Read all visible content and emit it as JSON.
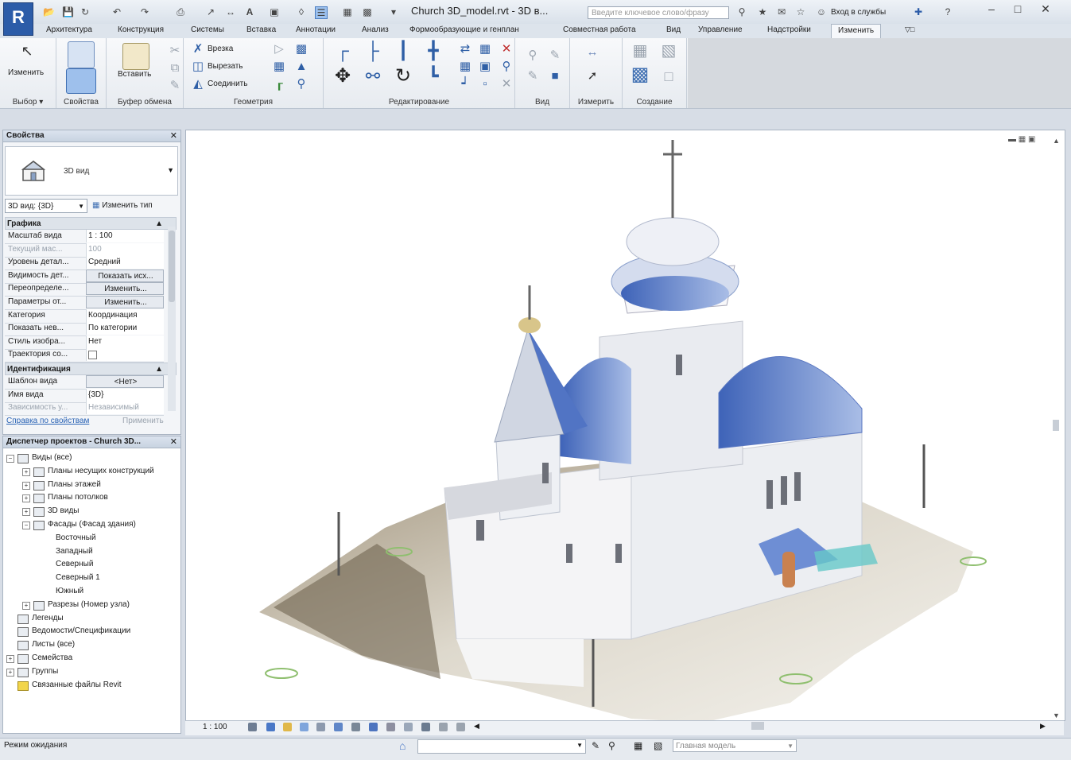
{
  "app": {
    "logo": "R",
    "window_title": "Church 3D_model.rvt - 3D в...",
    "search_placeholder": "Введите ключевое слово/фразу",
    "signin": "Вход в службы",
    "win_buttons": [
      "–",
      "□",
      "✕"
    ]
  },
  "ribbon_tabs": [
    "Архитектура",
    "Конструкция",
    "Системы",
    "Вставка",
    "Аннотации",
    "Анализ",
    "Формообразующие и генплан",
    "Совместная работа",
    "Вид",
    "Управление",
    "Надстройки",
    "Изменить"
  ],
  "ribbon_panels": {
    "select": "Выбор",
    "properties": "Свойства",
    "clipboard": "Буфер обмена",
    "geometry": "Геометрия",
    "modify": "Редактирование",
    "view": "Вид",
    "measure": "Измерить",
    "create": "Создание"
  },
  "ribbon_labels": {
    "modify_btn": "Изменить",
    "paste_btn": "Вставить",
    "cope": "Врезка",
    "cut": "Вырезать",
    "join": "Соединить"
  },
  "properties_pane": {
    "title": "Свойства",
    "type_name": "3D вид",
    "view_selector": "3D вид: {3D}",
    "edit_type": "Изменить тип",
    "groups": {
      "graphics": "Графика",
      "identity": "Идентификация"
    },
    "rows_graphics": [
      {
        "name": "Масштаб вида",
        "value": "1 : 100"
      },
      {
        "name": "Текущий мас...",
        "value": "100"
      },
      {
        "name": "Уровень детал...",
        "value": "Средний"
      },
      {
        "name": "Видимость дет...",
        "value": "Показать исх..."
      },
      {
        "name": "Переопределе...",
        "value": "Изменить..."
      },
      {
        "name": "Параметры от...",
        "value": "Изменить..."
      },
      {
        "name": "Категория",
        "value": "Координация"
      },
      {
        "name": "Показать нев...",
        "value": "По категории"
      },
      {
        "name": "Стиль изобра...",
        "value": "Нет"
      },
      {
        "name": "Траектория со...",
        "value": ""
      }
    ],
    "rows_identity": [
      {
        "name": "Шаблон вида",
        "value": "<Нет>"
      },
      {
        "name": "Имя вида",
        "value": "{3D}"
      },
      {
        "name": "Зависимость у...",
        "value": "Независимый"
      }
    ],
    "help_link": "Справка по свойствам",
    "apply": "Применить"
  },
  "browser_pane": {
    "title": "Диспетчер проектов - Church 3D...",
    "tree": [
      {
        "label": "Виды (все)",
        "level": 0,
        "toggle": "−"
      },
      {
        "label": "Планы несущих конструкций",
        "level": 1,
        "toggle": "+"
      },
      {
        "label": "Планы этажей",
        "level": 1,
        "toggle": "+"
      },
      {
        "label": "Планы потолков",
        "level": 1,
        "toggle": "+"
      },
      {
        "label": "3D виды",
        "level": 1,
        "toggle": "+"
      },
      {
        "label": "Фасады (Фасад здания)",
        "level": 1,
        "toggle": "−"
      },
      {
        "label": "Восточный",
        "level": 2,
        "toggle": ""
      },
      {
        "label": "Западный",
        "level": 2,
        "toggle": ""
      },
      {
        "label": "Северный",
        "level": 2,
        "toggle": ""
      },
      {
        "label": "Северный 1",
        "level": 2,
        "toggle": ""
      },
      {
        "label": "Южный",
        "level": 2,
        "toggle": ""
      },
      {
        "label": "Разрезы (Номер узла)",
        "level": 1,
        "toggle": "+"
      },
      {
        "label": "Легенды",
        "level": 0,
        "toggle": ""
      },
      {
        "label": "Ведомости/Спецификации",
        "level": 0,
        "toggle": ""
      },
      {
        "label": "Листы (все)",
        "level": 0,
        "toggle": ""
      },
      {
        "label": "Семейства",
        "level": 0,
        "toggle": "+"
      },
      {
        "label": "Группы",
        "level": 0,
        "toggle": "+"
      },
      {
        "label": "Связанные файлы Revit",
        "level": 0,
        "toggle": ""
      }
    ]
  },
  "viewbar": {
    "scale": "1 : 100"
  },
  "statusbar": {
    "status": "Режим ожидания",
    "model": "Главная модель"
  },
  "colors": {
    "accent": "#2c5ca8",
    "roof_blue": "#4e74c9",
    "link": "#2a63b5"
  }
}
